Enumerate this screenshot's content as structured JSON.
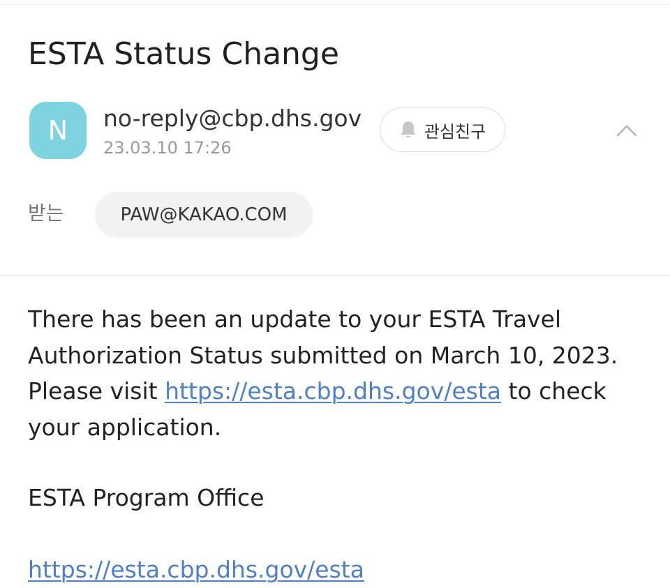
{
  "mail": {
    "subject": "ESTA Status Change",
    "sender": {
      "avatar_letter": "N",
      "avatar_color": "#7ed3e0",
      "email": "no-reply@cbp.dhs.gov",
      "date": "23.03.10 17:26"
    },
    "favorite_button": {
      "icon": "bell-icon",
      "label": "관심친구"
    },
    "collapse_icon": "chevron-up-icon",
    "recipient": {
      "label": "받는",
      "address": "PAW@KAKAO.COM"
    },
    "body": {
      "intro": "There has been an update to your ESTA Travel Authorization Status submitted on March 10, 2023. Please visit ",
      "link_text": "https://esta.cbp.dhs.gov/esta",
      "outro": " to check your application.",
      "signature": "ESTA Program Office",
      "footer_link": "https://esta.cbp.dhs.gov/esta"
    },
    "link_color": "#4d80c9"
  }
}
